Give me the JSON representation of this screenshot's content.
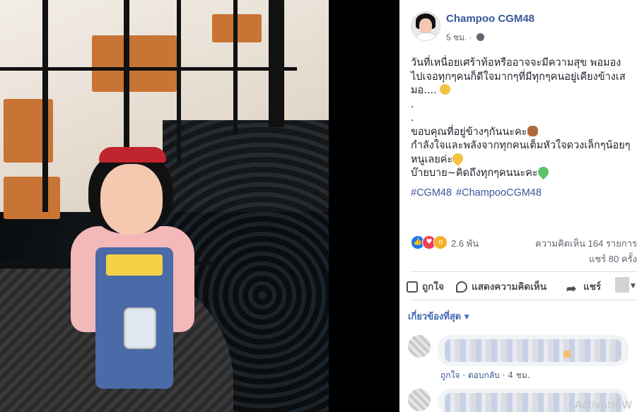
{
  "post": {
    "page_name": "Champoo CGM48",
    "time": "5 ชม.",
    "privacy_icon": "globe-icon",
    "text_lines": [
      "วันที่เหนื่อยเศร้าท้อหรืออาจจะมีความสุข พอมอง",
      "ไปเจอทุกๆคนก็ดีใจมากๆที่มีทุกๆคนอยู่เคียงข้างเส",
      "มอ....",
      ".",
      ".",
      "ขอบคุณที่อยู่ข้างๆกันนะคะ",
      "กำลังใจและพลังจากทุกคนเต็มหัวใจดวงเล็กๆน้อยๆ",
      "หนูเลยค่ะ",
      "บ๊ายบาย~คิดถึงทุกๆคนนะคะ"
    ],
    "hashtags": [
      "#CGM48",
      "#ChampooCGM48"
    ]
  },
  "reactions": {
    "icons": [
      "like-icon",
      "love-icon",
      "wow-icon"
    ],
    "count": "2.6 พัน",
    "comments": "ความคิดเห็น 164 รายการ",
    "shares": "แชร์ 80 ครั้ง"
  },
  "actions": {
    "like": "ถูกใจ",
    "comment": "แสดงความคิดเห็น",
    "share": "แชร์"
  },
  "comments_filter": "เกี่ยวข้องที่สุด",
  "comment1": {
    "like": "ถูกใจ",
    "reply": "ตอบกลับ",
    "time": "4 ชม."
  },
  "watermark": "Activate W",
  "colors": {
    "link": "#385898",
    "filter": "#4267b2",
    "like": "#1877f2",
    "love": "#f33e58",
    "wow": "#f7b125",
    "emoji_green": "#5dc26a",
    "emoji_yellow": "#f5c242",
    "emoji_bear": "#b06a3a"
  }
}
